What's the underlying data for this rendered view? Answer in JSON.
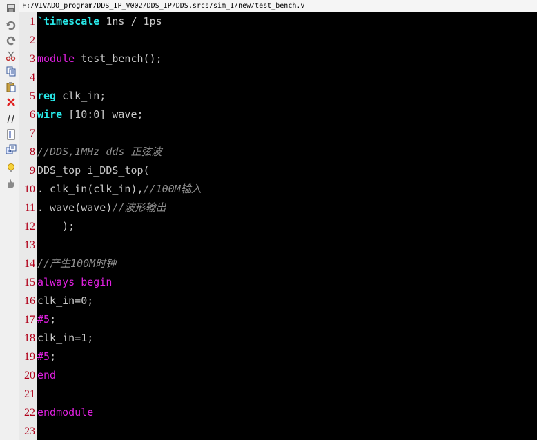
{
  "window": {
    "file_path": "F:/VIVADO_program/DDS_IP_V002/DDS_IP/DDS.srcs/sim_1/new/test_bench.v"
  },
  "toolbar": {
    "buttons": [
      {
        "icon": "save-icon"
      },
      {
        "icon": "undo-icon"
      },
      {
        "icon": "redo-icon"
      },
      {
        "icon": "cut-icon"
      },
      {
        "icon": "copy-icon"
      },
      {
        "icon": "paste-icon"
      },
      {
        "icon": "delete-icon"
      },
      {
        "icon": "comment-icon"
      },
      {
        "icon": "block-comment-icon"
      },
      {
        "icon": "template-icon"
      },
      {
        "icon": "lightbulb-icon"
      },
      {
        "icon": "hand-icon"
      }
    ]
  },
  "editor": {
    "current_line": 5,
    "colors": {
      "keyword": "#28e8e8",
      "directive": "#e020e0",
      "comment": "#909090",
      "text": "#c8c8c8",
      "line_number": "#b0001a",
      "background": "#000000"
    },
    "lines": [
      {
        "n": "1",
        "tokens": [
          {
            "t": "`timescale",
            "c": "kw"
          },
          {
            "t": " 1ns / 1ps",
            "c": "def"
          }
        ]
      },
      {
        "n": "2",
        "tokens": []
      },
      {
        "n": "3",
        "tokens": [
          {
            "t": "module",
            "c": "mag"
          },
          {
            "t": " test_bench();",
            "c": "def"
          }
        ]
      },
      {
        "n": "4",
        "tokens": []
      },
      {
        "n": "5",
        "tokens": [
          {
            "t": "reg",
            "c": "kw"
          },
          {
            "t": " clk_in;",
            "c": "def"
          }
        ]
      },
      {
        "n": "6",
        "tokens": [
          {
            "t": "wire",
            "c": "kw"
          },
          {
            "t": " [10:0] wave;",
            "c": "def"
          }
        ]
      },
      {
        "n": "7",
        "tokens": []
      },
      {
        "n": "8",
        "tokens": [
          {
            "t": "//DDS,1MHz dds 正弦波",
            "c": "cm"
          }
        ]
      },
      {
        "n": "9",
        "tokens": [
          {
            "t": "DDS_top i_DDS_top(",
            "c": "def"
          }
        ]
      },
      {
        "n": "10",
        "tokens": [
          {
            "t": ". clk_in(clk_in),",
            "c": "def"
          },
          {
            "t": "//100M输入",
            "c": "cm"
          }
        ]
      },
      {
        "n": "11",
        "tokens": [
          {
            "t": ". wave(wave)",
            "c": "def"
          },
          {
            "t": "//波形输出",
            "c": "cm"
          }
        ]
      },
      {
        "n": "12",
        "tokens": [
          {
            "t": "    );",
            "c": "def"
          }
        ]
      },
      {
        "n": "13",
        "tokens": []
      },
      {
        "n": "14",
        "tokens": [
          {
            "t": "//产生100M时钟",
            "c": "cm"
          }
        ]
      },
      {
        "n": "15",
        "tokens": [
          {
            "t": "always",
            "c": "mag"
          },
          {
            "t": " ",
            "c": "def"
          },
          {
            "t": "begin",
            "c": "mag"
          }
        ]
      },
      {
        "n": "16",
        "tokens": [
          {
            "t": "clk_in=0;",
            "c": "def"
          }
        ]
      },
      {
        "n": "17",
        "tokens": [
          {
            "t": "#5",
            "c": "mag"
          },
          {
            "t": ";",
            "c": "def"
          }
        ]
      },
      {
        "n": "18",
        "tokens": [
          {
            "t": "clk_in=1;",
            "c": "def"
          }
        ]
      },
      {
        "n": "19",
        "tokens": [
          {
            "t": "#5",
            "c": "mag"
          },
          {
            "t": ";",
            "c": "def"
          }
        ]
      },
      {
        "n": "20",
        "tokens": [
          {
            "t": "end",
            "c": "mag"
          }
        ]
      },
      {
        "n": "21",
        "tokens": []
      },
      {
        "n": "22",
        "tokens": [
          {
            "t": "endmodule",
            "c": "mag"
          }
        ]
      },
      {
        "n": "23",
        "tokens": []
      }
    ]
  }
}
